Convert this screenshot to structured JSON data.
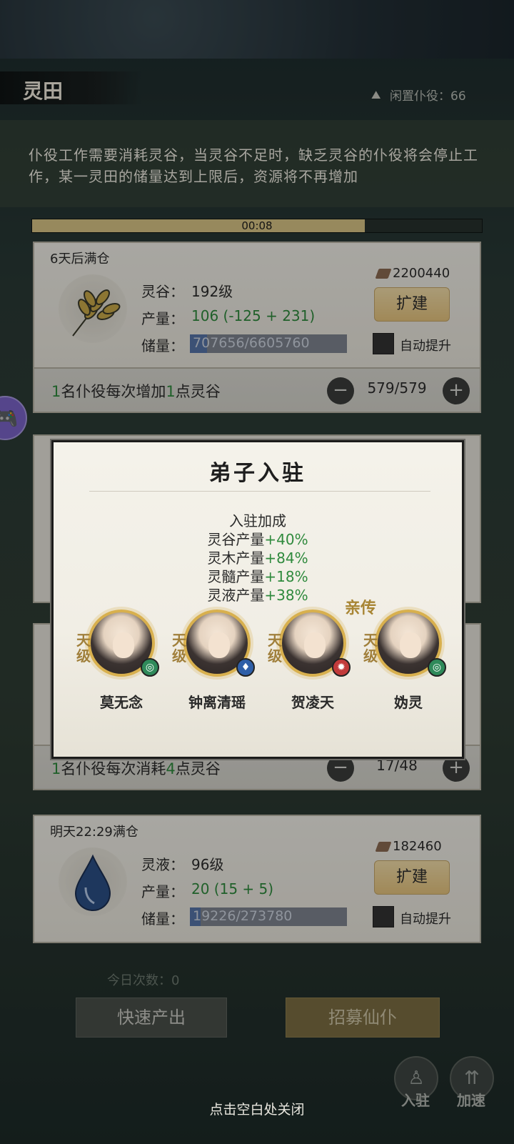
{
  "header": {
    "title": "灵田",
    "idle_workers_label": "闲置仆役：66"
  },
  "description": "仆役工作需要消耗灵谷，当灵谷不足时，缺乏灵谷的仆役将会停止工作，某一灵田的储量达到上限后，资源将不再增加",
  "timer": {
    "text": "00:08",
    "progress": 0.74
  },
  "fields": [
    {
      "status": "6天后满仓",
      "name_label": "灵谷：",
      "level": "192级",
      "production_label": "产量：",
      "production": "106 (-125 + 231)",
      "storage_label": "储量：",
      "storage": "707656/6605760",
      "storage_fraction": 0.107,
      "cost": "2200440",
      "expand_label": "扩建",
      "auto_label": "自动提升",
      "icon": "wheat-icon",
      "worker_text_a": "1",
      "worker_text_b": "名仆役每次增加",
      "worker_text_c": "1",
      "worker_text_d": "点灵谷",
      "worker_count": "579/579"
    },
    {
      "worker_text_a": "1",
      "worker_text_b": "名仆役每次消耗",
      "worker_text_c": "4",
      "worker_text_d": "点灵谷",
      "worker_count": "17/48"
    },
    {
      "status": "明天22:29满仓",
      "name_label": "灵液：",
      "level": "96级",
      "production_label": "产量：",
      "production": "20 (15 + 5)",
      "storage_label": "储量：",
      "storage": "19226/273780",
      "storage_fraction": 0.07,
      "cost": "182460",
      "expand_label": "扩建",
      "auto_label": "自动提升",
      "icon": "water-drop-icon"
    }
  ],
  "bottom": {
    "today_count": "今日次数：0",
    "quick_label": "快速产出",
    "recruit_label": "招募仙仆",
    "station_label": "入驻",
    "speed_label": "加速",
    "close_hint": "点击空白处关闭"
  },
  "modal": {
    "title": "弟子入驻",
    "bonus_title": "入驻加成",
    "bonuses": [
      {
        "name": "灵谷产量",
        "value": "+40%"
      },
      {
        "name": "灵木产量",
        "value": "+84%"
      },
      {
        "name": "灵髓产量",
        "value": "+18%"
      },
      {
        "name": "灵液产量",
        "value": "+38%"
      }
    ],
    "rank_tag": "亲传",
    "disciples": [
      {
        "name": "莫无念",
        "tier": "天级",
        "element_color": "#2f8a5a"
      },
      {
        "name": "钟离清瑶",
        "tier": "天级",
        "element_color": "#2f5fa8"
      },
      {
        "name": "贺凌天",
        "tier": "天级",
        "element_color": "#c23b3b"
      },
      {
        "name": "妫灵",
        "tier": "天级",
        "element_color": "#2f8a5a"
      }
    ]
  },
  "colors": {
    "green": "#2f8a3d",
    "gold": "#d8b04e",
    "expand": "#e6c47e"
  }
}
